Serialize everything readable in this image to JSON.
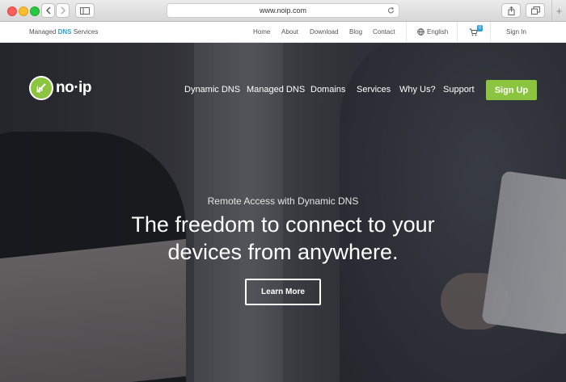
{
  "browser": {
    "url": "www.noip.com"
  },
  "utility_bar": {
    "brand_prefix": "Managed ",
    "brand_highlight": "DNS",
    "brand_suffix": " Services",
    "links": [
      "Home",
      "About",
      "Download",
      "Blog",
      "Contact"
    ],
    "language": "English",
    "cart_count": "0",
    "sign_in": "Sign In"
  },
  "header": {
    "logo_text": "no·ip",
    "nav": [
      "Dynamic DNS",
      "Managed DNS",
      "Domains",
      "Services",
      "Why Us?",
      "Support"
    ],
    "signup_label": "Sign Up"
  },
  "hero": {
    "subtitle": "Remote Access with Dynamic DNS",
    "headline_line1": "The freedom to connect to your",
    "headline_line2": "devices from anywhere.",
    "cta_label": "Learn More"
  },
  "colors": {
    "accent_green": "#8bc53f",
    "accent_blue": "#2f9fd8"
  },
  "icons": [
    "back-icon",
    "forward-icon",
    "sidebar-icon",
    "reload-icon",
    "share-icon",
    "tabs-icon",
    "plus-icon",
    "globe-icon",
    "cart-icon"
  ]
}
